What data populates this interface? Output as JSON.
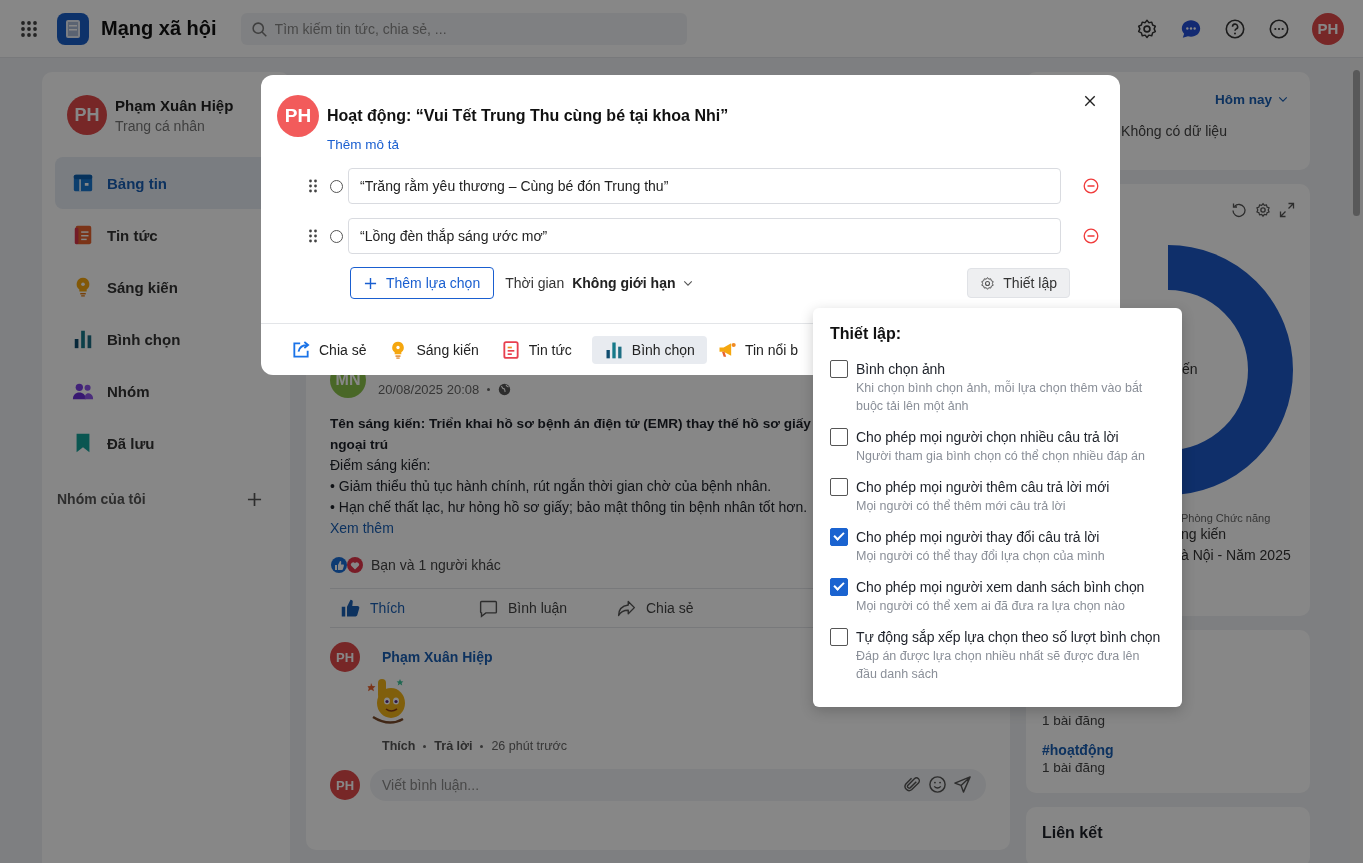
{
  "header": {
    "app_title": "Mạng xã hội",
    "search": {
      "placeholder": "Tìm kiếm tin tức, chia sẻ, ..."
    },
    "avatar": "PH"
  },
  "sidebar": {
    "profile": {
      "avatar": "PH",
      "name": "Phạm Xuân Hiệp",
      "subtitle": "Trang cá nhân"
    },
    "items": [
      {
        "label": "Bảng tin",
        "kind": "feed",
        "selected": true
      },
      {
        "label": "Tin tức",
        "kind": "news",
        "selected": false
      },
      {
        "label": "Sáng kiến",
        "kind": "idea",
        "selected": false
      },
      {
        "label": "Bình chọn",
        "kind": "poll",
        "selected": false
      },
      {
        "label": "Nhóm",
        "kind": "group",
        "selected": false
      },
      {
        "label": "Đã lưu",
        "kind": "saved",
        "selected": false
      }
    ],
    "groups_heading": "Nhóm của tôi"
  },
  "post": {
    "avatar": "MN",
    "time": "20/08/2025 20:08",
    "title_lines": [
      "Tên sáng kiến: Triển khai hồ sơ bệnh án điện tử (EMR) thay thế hồ sơ giấy",
      "ngoại trú"
    ],
    "body": [
      "Điểm sáng kiến:",
      "• Giảm thiểu thủ tục hành chính, rút ngắn thời gian chờ của bệnh nhân.",
      "• Hạn chế thất lạc, hư hỏng hồ sơ giấy; bảo mật thông tin bệnh nhân tốt hơn."
    ],
    "more": "Xem thêm",
    "reactions": "Bạn và 1 người khác",
    "actions": [
      {
        "label": "Thích",
        "kind": "like",
        "selected": true
      },
      {
        "label": "Bình luận",
        "kind": "comment",
        "selected": false
      },
      {
        "label": "Chia sẻ",
        "kind": "share",
        "selected": false
      }
    ],
    "comments": [
      {
        "avatar": "PH",
        "author": "Phạm Xuân Hiệp",
        "attachment": {
          "kind": "picture"
        },
        "actions": [
          "Thích",
          "Trả lời"
        ],
        "time": "26 phút trước"
      }
    ],
    "comment_input": {
      "avatar": "PH",
      "placeholder": "Viết bình luận..."
    }
  },
  "right_panel": {
    "period": "Hôm nay",
    "empty": "Không có dữ liệu",
    "center_label": "ến",
    "caption": "Phòng Chức năng",
    "title_lines": [
      "ng kiến",
      "à Nội - Năm 2025"
    ],
    "tags": [
      {
        "count": "1 bài đăng"
      },
      {
        "name": "#hoạtđộng",
        "count": "1 bài đăng"
      }
    ],
    "links_title": "Liên kết"
  },
  "poll_dialog": {
    "avatar": "PH",
    "title": "Hoạt động: “Vui Tết Trung Thu cùng bé tại khoa Nhi”",
    "add_description": "Thêm mô tả",
    "options": [
      {
        "value": "“Trăng rằm yêu thương – Cùng bé đón Trung thu”",
        "selected": false
      },
      {
        "value": "“Lồng đèn thắp sáng ước mơ”",
        "selected": false
      }
    ],
    "add_option": "Thêm lựa chọn",
    "duration_label": "Thời gian",
    "duration": "Không giới hạn",
    "settings_button": "Thiết lập",
    "toolbar": [
      {
        "label": "Chia sẻ",
        "kind": "share",
        "selected": false
      },
      {
        "label": "Sáng kiến",
        "kind": "idea",
        "selected": false
      },
      {
        "label": "Tin tức",
        "kind": "article",
        "selected": false
      },
      {
        "label": "Bình chọn",
        "kind": "poll",
        "selected": true
      },
      {
        "label": "Tin nổi b",
        "kind": "highlight",
        "selected": false
      }
    ]
  },
  "settings_popover": {
    "title": "Thiết lập:",
    "options": [
      {
        "label": "Bình chọn ảnh",
        "description": "Khi chọn bình chọn ảnh, mỗi lựa chọn thêm vào bắt buộc tải lên một ảnh",
        "checked": false
      },
      {
        "label": "Cho phép mọi người chọn nhiều câu trả lời",
        "description": "Người tham gia bình chọn có thể chọn nhiều đáp án",
        "checked": false
      },
      {
        "label": "Cho phép mọi người thêm câu trả lời mới",
        "description": "Mọi người có thể thêm mới câu trả lời",
        "checked": false
      },
      {
        "label": "Cho phép mọi người thay đổi câu trả lời",
        "description": "Mọi người có thể thay đổi lựa chọn của mình",
        "checked": true
      },
      {
        "label": "Cho phép mọi người xem danh sách bình chọn",
        "description": "Mọi người có thể xem ai đã đưa ra lựa chọn nào",
        "checked": true
      },
      {
        "label": "Tự động sắp xếp lựa chọn theo số lượt bình chọn",
        "description": "Đáp án được lựa chọn nhiều nhất sẽ được đưa lên đầu danh sách",
        "checked": false
      }
    ]
  }
}
